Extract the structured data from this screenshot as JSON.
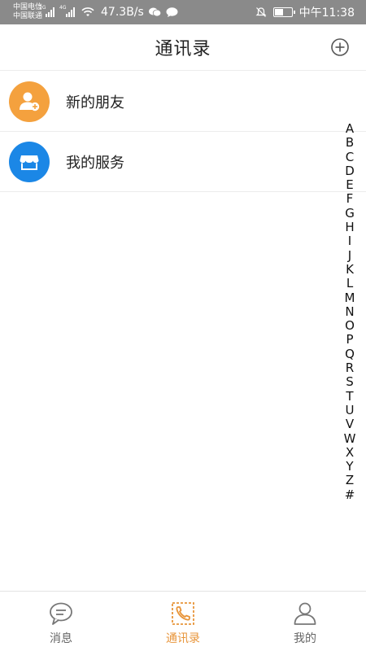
{
  "status_bar": {
    "carrier1": "中国电信",
    "carrier2": "中国联通",
    "net1": "2G",
    "net2": "4G",
    "speed": "47.3B/s",
    "time": "中午11:38"
  },
  "header": {
    "title": "通讯录"
  },
  "rows": [
    {
      "label": "新的朋友",
      "icon": "add-user-icon",
      "color": "#f4a13e"
    },
    {
      "label": "我的服务",
      "icon": "store-icon",
      "color": "#1b87e6"
    }
  ],
  "alphabet": [
    "A",
    "B",
    "C",
    "D",
    "E",
    "F",
    "G",
    "H",
    "I",
    "J",
    "K",
    "L",
    "M",
    "N",
    "O",
    "P",
    "Q",
    "R",
    "S",
    "T",
    "U",
    "V",
    "W",
    "X",
    "Y",
    "Z",
    "#"
  ],
  "tabs": [
    {
      "label": "消息",
      "icon": "chat-bubble-icon",
      "active": false
    },
    {
      "label": "通讯录",
      "icon": "phone-book-icon",
      "active": true
    },
    {
      "label": "我的",
      "icon": "person-icon",
      "active": false
    }
  ],
  "colors": {
    "accent": "#e8953a",
    "status_bar": "#8a8a8a"
  }
}
